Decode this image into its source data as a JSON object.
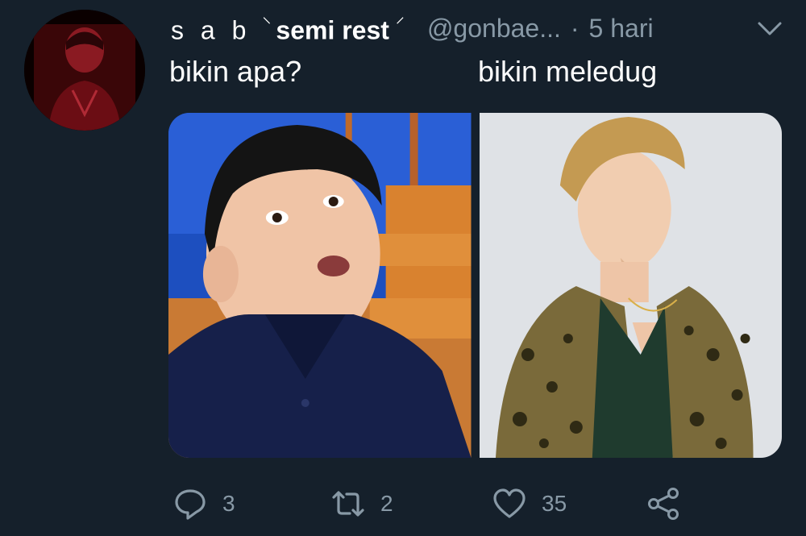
{
  "user": {
    "display_name": "s a b",
    "display_name_sep": "⸌",
    "display_name_sub": "semi rest",
    "display_name_sep2": "⸍",
    "handle": "@gonbae...",
    "separator": "·",
    "time": "5 hari"
  },
  "tweet": {
    "text_left": "bikin apa?",
    "text_right": "bikin meledug"
  },
  "actions": {
    "reply_count": "3",
    "retweet_count": "2",
    "like_count": "35"
  },
  "colors": {
    "background": "#15202b",
    "secondary_text": "#8899a6"
  }
}
